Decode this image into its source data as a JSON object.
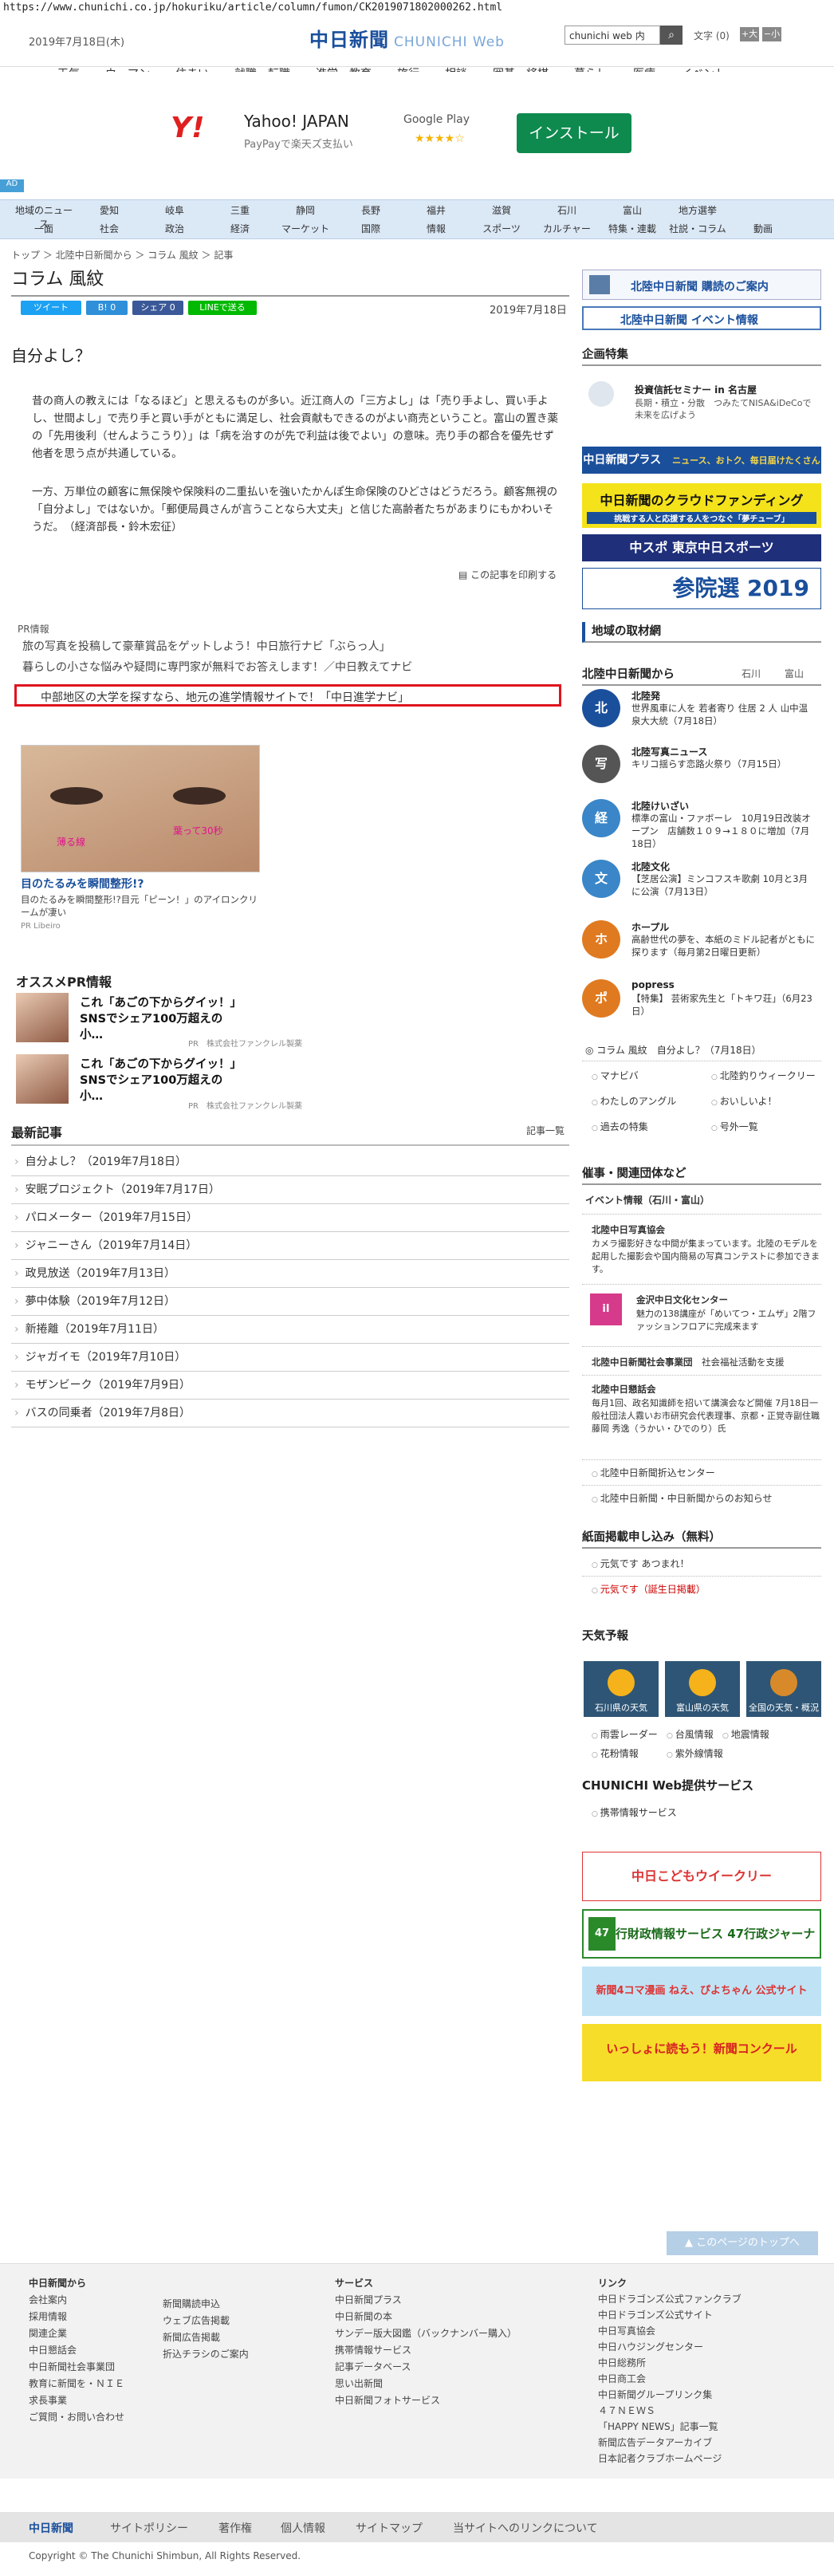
{
  "url": "https://www.chunichi.co.jp/hokuriku/article/column/fumon/CK2019071802000262.html",
  "header": {
    "date": "2019年7月18日(木)",
    "logo": "中日新聞",
    "logo_sub": "CHUNICHI Web",
    "search_value": "chunichi web 内",
    "search_icon": "search-icon",
    "font_label": "文字",
    "font_size": "(0)",
    "font_up": "+大",
    "font_down": "−小"
  },
  "gnav": [
    "天気",
    "ウーマン",
    "住まい",
    "就職・転職",
    "進学・教育",
    "旅行",
    "相談",
    "囲碁・将棋",
    "暮らし",
    "医療",
    "イベント"
  ],
  "ad": {
    "brand": "Y!",
    "title": "Yahoo! JAPAN",
    "sub": "PayPayで楽天ズ支払い",
    "store": "Google Play",
    "stars": "★★★★☆",
    "button": "インストール",
    "badge": "AD"
  },
  "subnav": {
    "row1": [
      "地域のニュース",
      "愛知",
      "岐阜",
      "三重",
      "静岡",
      "長野",
      "福井",
      "滋賀",
      "石川",
      "富山",
      "地方選挙"
    ],
    "row2": [
      "一面",
      "社会",
      "政治",
      "経済",
      "マーケット",
      "国際",
      "情報",
      "スポーツ",
      "カルチャー",
      "特集・連載",
      "社説・コラム",
      "動画"
    ]
  },
  "breadcrumb": "トップ ＞ 北陸中日新聞から ＞ コラム 風紋 ＞ 記事",
  "page_title": "コラム 風紋",
  "share": {
    "tweet": "ツイート",
    "b": "B! 0",
    "fb": "シェア 0",
    "line": "LINEで送る"
  },
  "article": {
    "date": "2019年7月18日",
    "headline": "自分よし？",
    "p1": "昔の商人の教えには「なるほど」と思えるものが多い。近江商人の「三方よし」は「売り手よし、買い手よし、世間よし」で売り手と買い手がともに満足し、社会貢献もできるのがよい商売ということ。富山の置き薬の「先用後利（せんようこうり）」は「病を治すのが先で利益は後でよい」の意味。売り手の都合を優先せず他者を思う点が共通している。",
    "p2": "一方、万単位の顧客に無保険や保険料の二重払いを強いたかんぽ生命保険のひどさはどうだろう。顧客無視の「自分よし」ではないか。「郵便局員さんが言うことなら大丈夫」と信じた高齢者たちがあまりにもかわいそうだ。　（経済部長・鈴木宏征）",
    "print": "この記事を印刷する"
  },
  "pr": {
    "label": "PR情報",
    "lines": [
      "旅の写真を投稿して豪華賞品をゲットしよう！中日旅行ナビ「ぶらっ人」",
      "暮らしの小さな悩みや疑問に専門家が無料でお答えします！／中日教えてナビ"
    ],
    "highlight": "中部地区の大学を探すなら、地元の進学情報サイトで！「中日進学ナビ」"
  },
  "adbox": {
    "overlay1": "薄る線",
    "overlay2": "葉って30秒",
    "title": "目のたるみを瞬間整形!?",
    "desc": "目のたるみを瞬間整形!?目元「ピーン！」のアイロンクリームが凄い",
    "source": "PR Libeiro"
  },
  "osusume": {
    "title": "オススメPR情報",
    "items": [
      {
        "text": "これ「あごの下からグイッ！」SNSでシェア100万超えの小…",
        "src": "PR　株式会社ファンクレル製薬"
      },
      {
        "text": "これ「あごの下からグイッ！」SNSでシェア100万超えの小…",
        "src": "PR　株式会社ファンクレル製薬"
      }
    ]
  },
  "latest": {
    "title": "最新記事",
    "more": "記事一覧",
    "items": [
      "自分よし？（2019年7月18日）",
      "安眠プロジェクト（2019年7月17日）",
      "パロメーター（2019年7月15日）",
      "ジャニーさん（2019年7月14日）",
      "政見放送（2019年7月13日）",
      "夢中体験（2019年7月12日）",
      "新捲離（2019年7月11日）",
      "ジャガイモ（2019年7月10日）",
      "モザンビーク（2019年7月9日）",
      "バスの同乗者（2019年7月8日）"
    ]
  },
  "right": {
    "subscribe": "北陸中日新聞 購読のご案内",
    "event": "北陸中日新聞 イベント情報",
    "kikaku": "企画特集",
    "kikaku_title": "投資信託セミナー in 名古屋",
    "kikaku_desc": "長期・積立・分散　つみたてNISA&iDeCoで未来を広げよう",
    "b1": "中日新聞プラス",
    "b1s": "ニュース、おトク、毎日届けたくさん",
    "b2": "中日新聞のクラウドファンディング",
    "b2s": "挑戦する人と応援する人をつなぐ「夢チューブ」",
    "b3": "中スポ 東京中日スポーツ",
    "b4": "参院選 2019",
    "chiiki": "地域の取材網",
    "hokuriku": "北陸中日新聞から",
    "ishikawa": "石川",
    "toyama": "富山",
    "rows": [
      {
        "ico": "北",
        "title": "北陸発",
        "text": "世界風車に人を 若者寄り 住居 2 人 山中温泉大大統（7月18日）"
      },
      {
        "ico": "写",
        "title": "北陸写真ニュース",
        "text": "キリコ揺らす恋路火祭り（7月15日）"
      },
      {
        "ico": "経",
        "title": "北陸けいざい",
        "text": "標準の富山・ファボーレ　10月19日改装オープン　店舗数１０９→１８０に増加（7月18日）"
      },
      {
        "ico": "文",
        "title": "北陸文化",
        "text": "【芝居公演】ミンコフスキ歌劇 10月と3月に公演（7月13日）"
      },
      {
        "ico": "ホ",
        "title": "ホープル",
        "text": "高齢世代の夢を、本紙のミドル記者がともに探ります（毎月第2日曜日更新）"
      },
      {
        "ico": "ポ",
        "title": "popress",
        "text": "【特集】 芸術家先生と「トキワ荘」（6月23日）"
      }
    ],
    "colum": "コラム 風紋",
    "colum_sub": "自分よし？（7月18日）",
    "links": [
      "マナビバ",
      "北陸釣りウィークリー",
      "わたしのアングル",
      "おいしいよ！",
      "過去の特集",
      "号外一覧"
    ],
    "rel_title": "催事・関連団体など",
    "rel_event": "イベント情報（石川・富山）",
    "rel_rows": [
      {
        "title": "北陸中日写真協会",
        "text": "カメラ撮影好きな中間が集まっています。北陸のモデルを起用した撮影会や国内簡易の写真コンテストに参加できます。"
      },
      {
        "title": "金沢中日文化センター",
        "text": "魅力の138講座が「めいてつ・エムザ」2階ファッションフロアに完成来ます"
      },
      {
        "title": "北陸中日新聞社会事業団",
        "text": "社会福祉活動を支援"
      },
      {
        "title": "北陸中日懇話会",
        "text": "毎月1回、政名知識師を招いて講演会など開催 7月18日一般社団法人霧いお市研究会代表理事、京都・正覚寺副住職 藤岡 秀逸（うかい・ひでのり）氏"
      }
    ],
    "rel_links": [
      "北陸中日新聞折込センター",
      "北陸中日新聞・中日新聞からのお知らせ"
    ],
    "apply_title": "紙面掲載申し込み（無料）",
    "apply": [
      "元気です あつまれ！",
      "元気です（誕生日掲載）"
    ],
    "tenki_title": "天気予報",
    "tenki": [
      "石川県の天気",
      "富山県の天気",
      "全国の天気・概況"
    ],
    "tenki_links": [
      "雨雲レーダー",
      "台風情報",
      "地震情報",
      "花粉情報",
      "紫外線情報"
    ],
    "svc_title": "CHUNICHI Web提供サービス",
    "svc": "携帯情報サービス",
    "sb1": "中日こどもウイークリー",
    "sb2": "行財政情報サービス 47行政ジャーナル",
    "sb3": "新聞4コマ漫画 ねえ、ぴよちゃん 公式サイト",
    "sb4": "いっしょに読もう！新聞コンクール"
  },
  "footer": {
    "totop": "このページのトップへ",
    "col1_head": "中日新聞から",
    "col1": [
      "会社案内",
      "採用情報",
      "関連企業",
      "中日懇話会",
      "中日新聞社会事業団",
      "教育に新聞を・ＮＩＥ",
      "求長事業",
      "ご質問・お問い合わせ"
    ],
    "col2": [
      "新聞購読申込",
      "ウェブ広告掲載",
      "新聞広告掲載",
      "折込チラシのご案内"
    ],
    "col3_head": "サービス",
    "col3": [
      "中日新聞プラス",
      "中日新聞の本",
      "サンデー版大図鑑（バックナンバー購入）",
      "携帯情報サービス",
      "記事データベース",
      "思い出新聞",
      "中日新聞フォトサービス"
    ],
    "col4_head": "リンク",
    "col4": [
      "中日ドラゴンズ公式ファンクラブ",
      "中日ドラゴンズ公式サイト",
      "中日写真協会",
      "中日ハウジングセンター",
      "中日総務所",
      "中日商工会",
      "中日新聞グループリンク集",
      "４７ＮＥＷＳ",
      "「HAPPY NEWS」記事一覧",
      "新聞広告データアーカイブ",
      "日本記者クラブホームページ"
    ],
    "bar": [
      "中日新聞",
      "サイトポリシー",
      "著作権",
      "個人情報",
      "サイトマップ",
      "当サイトへのリンクについて"
    ],
    "copyright": "Copyright © The Chunichi Shimbun, All Rights Reserved."
  },
  "colors": {
    "brand": "#1a4f9c",
    "highlight": "#e0141e",
    "navbg": "#dbe8f6"
  }
}
